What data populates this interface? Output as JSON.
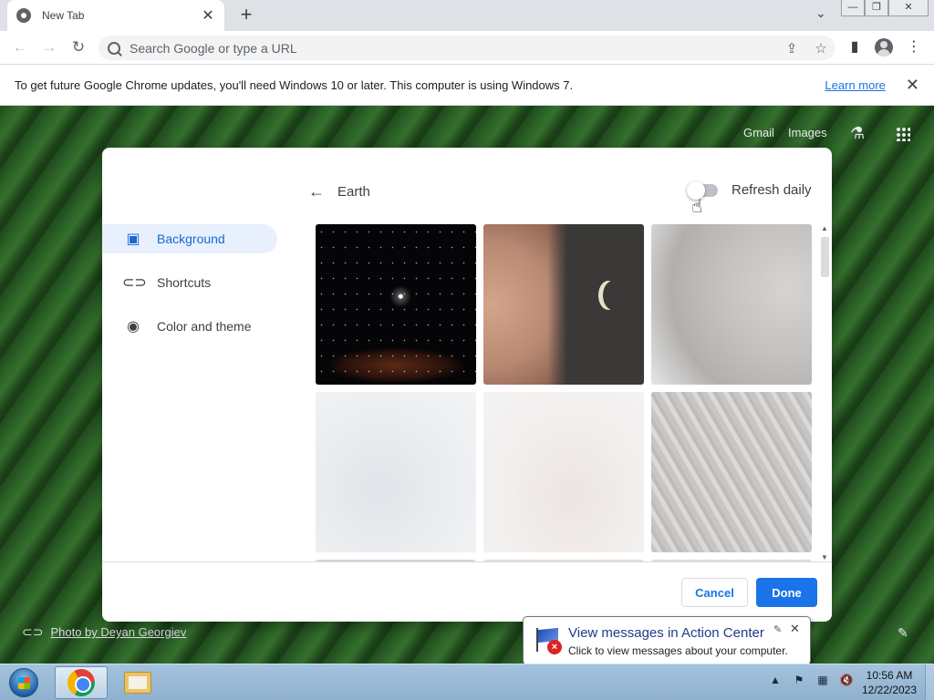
{
  "browser": {
    "tab_title": "New Tab",
    "tab_close": "✕",
    "new_tab": "+",
    "tab_search": "⌄",
    "window_controls": {
      "minimize": "—",
      "restore": "❐",
      "close": "✕"
    }
  },
  "toolbar": {
    "back": "←",
    "forward": "→",
    "reload": "↻",
    "omnibox_placeholder": "Search Google or type a URL",
    "share": "⇪",
    "bookmark": "☆",
    "side_panel": "▮",
    "menu": "⋮"
  },
  "infobar": {
    "message": "To get future Google Chrome updates, you'll need Windows 10 or later. This computer is using Windows 7.",
    "link": "Learn more",
    "close": "✕"
  },
  "ntp": {
    "gmail": "Gmail",
    "images": "Images",
    "labs_icon": "⚗",
    "photo_credit": "Photo by Deyan Georgiev",
    "edit_icon": "✎"
  },
  "dialog": {
    "sidebar": [
      {
        "label": "Background",
        "icon": "▣",
        "active": true
      },
      {
        "label": "Shortcuts",
        "icon": "⊂⊃",
        "active": false
      },
      {
        "label": "Color and theme",
        "icon": "◉",
        "active": false
      }
    ],
    "back_icon": "←",
    "collection_title": "Earth",
    "refresh_label": "Refresh daily",
    "refresh_on": false,
    "scroll_up": "▲",
    "scroll_down": "▼",
    "cancel_label": "Cancel",
    "done_label": "Done"
  },
  "balloon": {
    "title": "View messages in Action Center",
    "subtitle": "Click to view messages about your computer.",
    "pin": "✎",
    "close": "✕",
    "error_mark": "×"
  },
  "taskbar": {
    "tray": [
      "▲",
      "⚑",
      "▦",
      "🔇"
    ],
    "time": "10:56 AM",
    "date": "12/22/2023"
  },
  "colors": {
    "accent": "#1a73e8",
    "active_nav_bg": "#e8f0fe",
    "taskbar": "#a3c2dd"
  }
}
